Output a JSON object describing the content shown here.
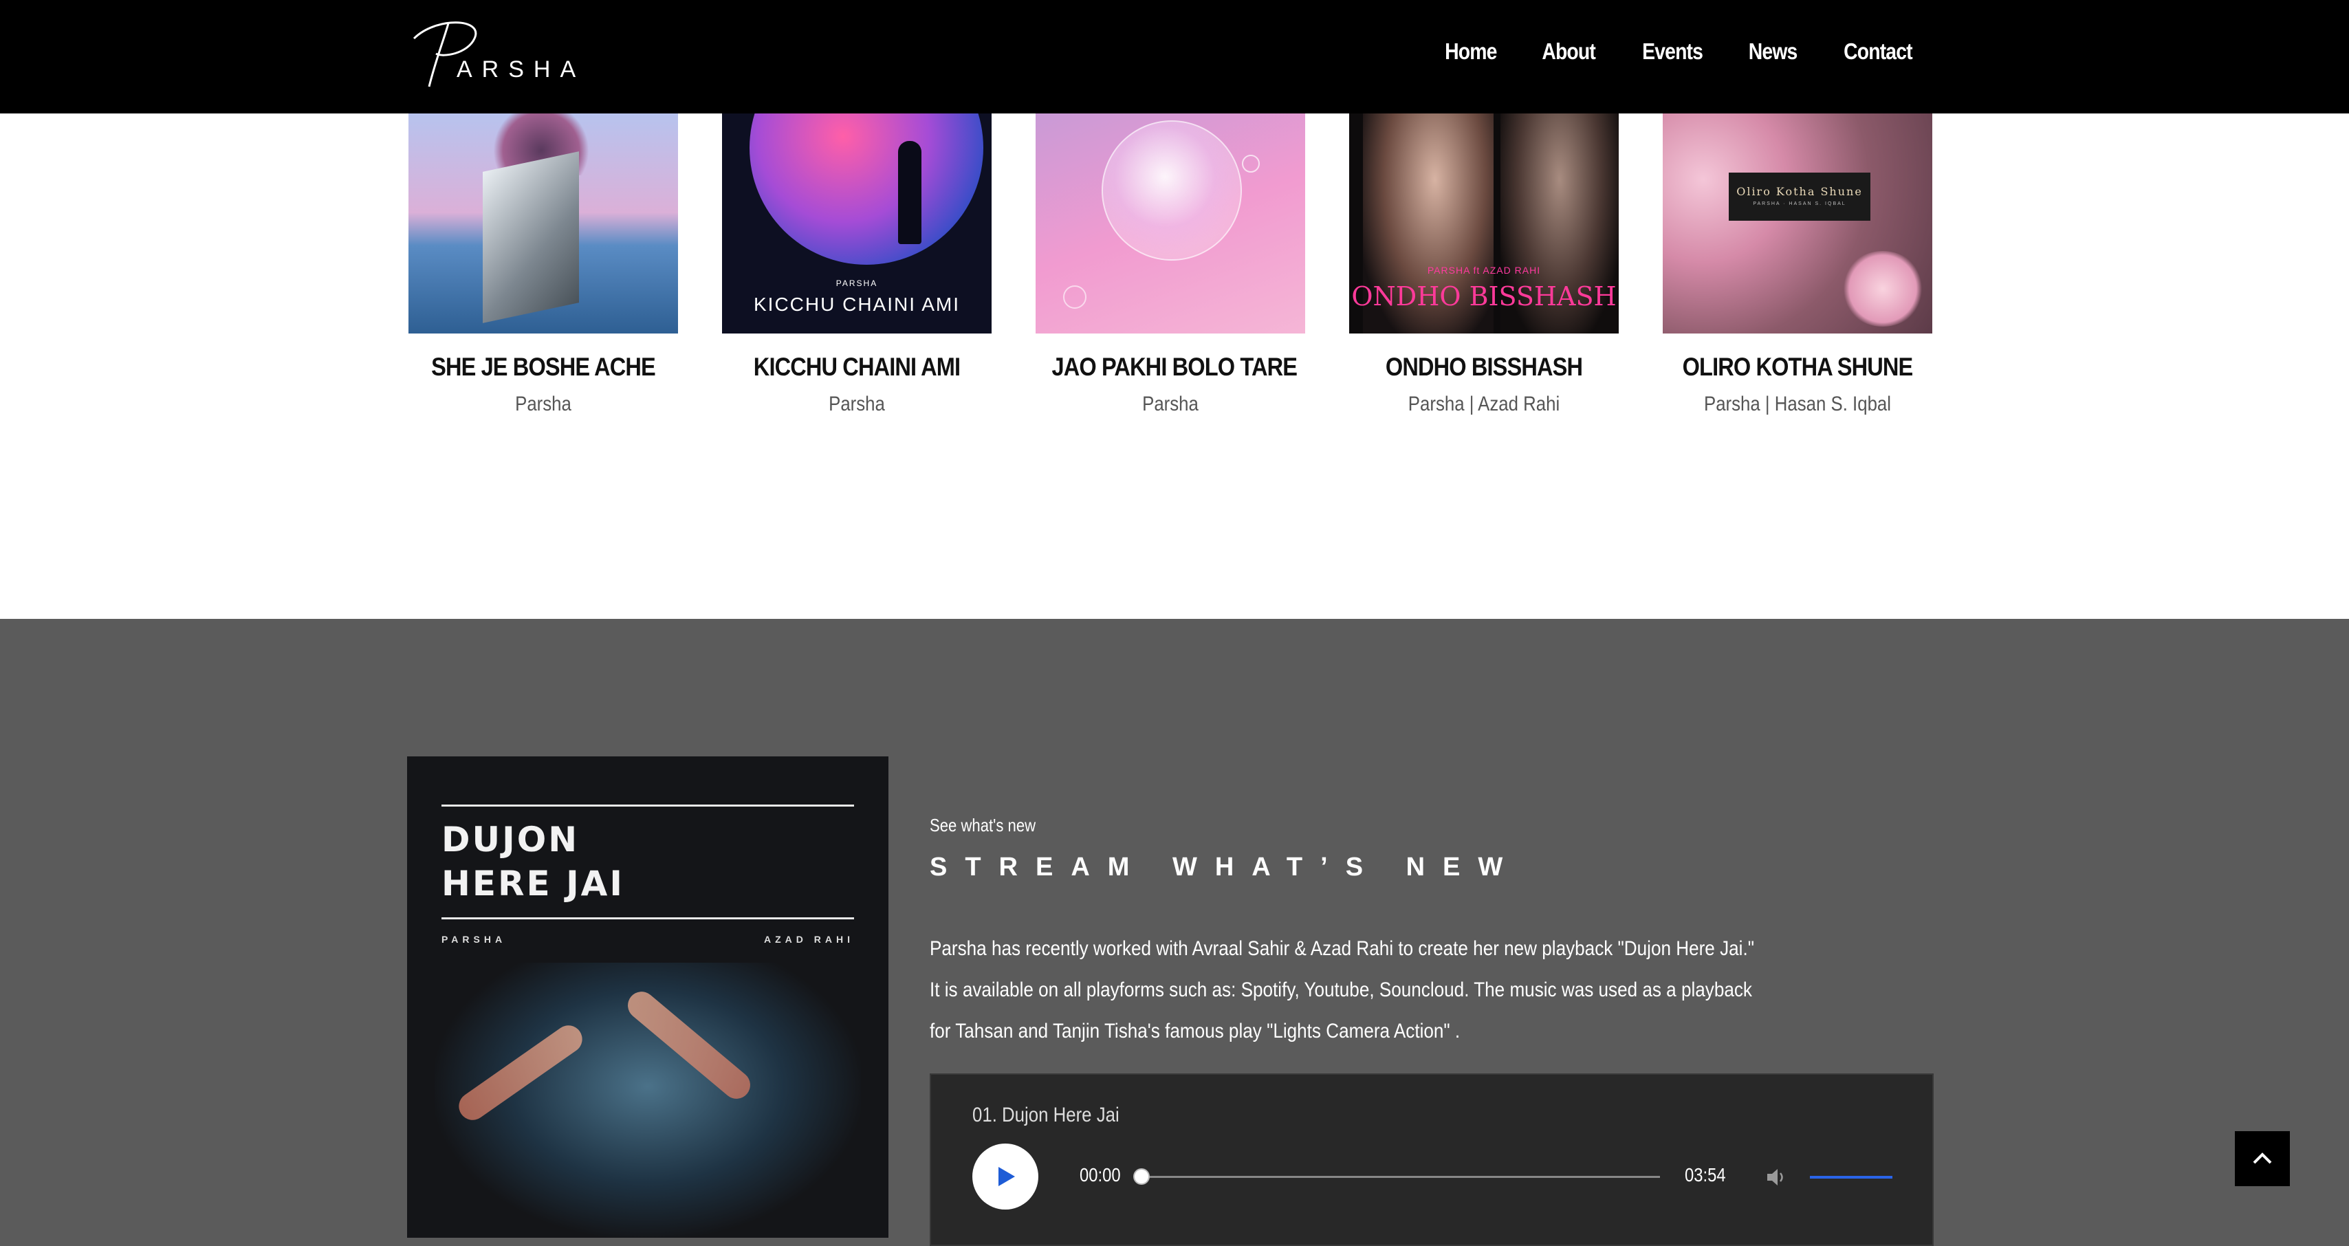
{
  "header": {
    "logo_text": "PARSHA",
    "nav": [
      "Home",
      "About",
      "Events",
      "News",
      "Contact"
    ]
  },
  "albums": [
    {
      "title": "SHE JE BOSHE ACHE",
      "artist": "Parsha"
    },
    {
      "title": "KICCHU CHAINI AMI",
      "artist": "Parsha",
      "cover_text_small": "PARSHA",
      "cover_text": "KICCHU CHAINI AMI"
    },
    {
      "title": "JAO PAKHI BOLO TARE",
      "artist": "Parsha"
    },
    {
      "title": "ONDHO BISSHASH",
      "artist": "Parsha | Azad Rahi",
      "cover_text_small": "PARSHA ft AZAD RAHI",
      "cover_text": "ONDHO BISSHASH"
    },
    {
      "title": "OLIRO KOTHA SHUNE",
      "artist": "Parsha | Hasan S. Iqbal",
      "cover_text": "Oliro Kotha Shune",
      "cover_text_small": "PARSHA · HASAN S. IQBAL"
    }
  ],
  "feature": {
    "cover": {
      "line1": "DUJON",
      "line2": "HERE JAI",
      "left_small": "PARSHA",
      "right_small": "AZAD RAHI"
    },
    "eyebrow": "See what's new",
    "heading": "STREAM WHAT’S NEW",
    "description": "Parsha has recently worked with Avraal Sahir & Azad Rahi to create her new playback \"Dujon Here Jai.\" It is available on all playforms such as: Spotify, Youtube, Souncloud. The music was used as a playback for Tahsan and Tanjin Tisha's famous play \"Lights Camera Action\" ."
  },
  "player": {
    "track": "01. Dujon Here Jai",
    "current_time": "00:00",
    "duration": "03:54",
    "progress": 0,
    "volume": 1
  },
  "colors": {
    "accent": "#1e5cd6",
    "section_bg": "#5b5b5b",
    "player_bg": "#282828"
  }
}
